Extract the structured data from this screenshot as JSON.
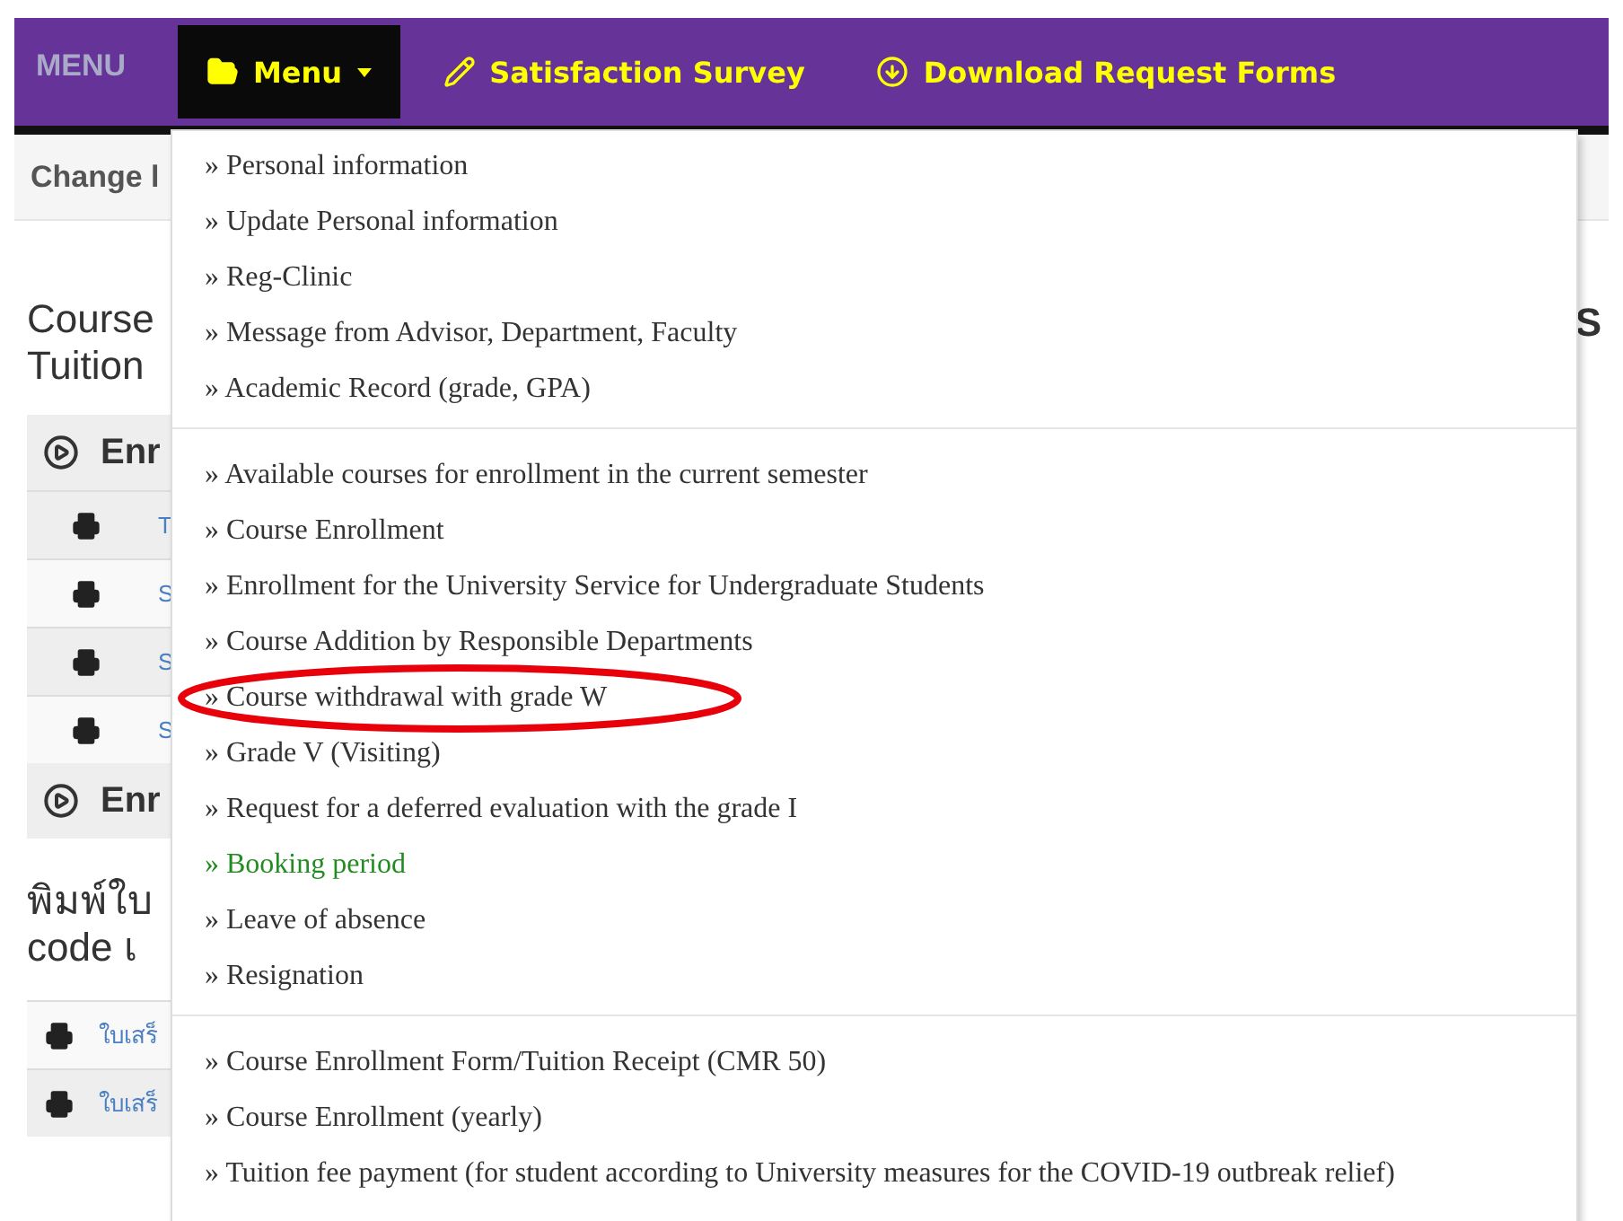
{
  "navbar": {
    "brand": "MENU",
    "items": [
      {
        "label": "Menu",
        "kind": "dropdown",
        "expanded": true
      },
      {
        "label": "Satisfaction Survey",
        "kind": "link"
      },
      {
        "label": "Download Request Forms",
        "kind": "link"
      }
    ]
  },
  "language_bar": {
    "label": "Change l"
  },
  "page": {
    "heading_lines": [
      "Course",
      "Tuition"
    ],
    "right_heading": "S",
    "panels": [
      {
        "title": "Enr",
        "rows": [
          "T",
          "S",
          "S",
          "S"
        ]
      },
      {
        "title": "Enr"
      }
    ],
    "print_heading_lines": [
      "พิมพ์ใบ",
      "code เ"
    ],
    "print_rows": [
      "ใบเสร็",
      "ใบเสร็"
    ]
  },
  "dropdown": {
    "groups": [
      {
        "items": [
          {
            "label": "» Personal information",
            "circled": false
          },
          {
            "label": "» Update Personal information",
            "circled": false
          },
          {
            "label": "» Reg-Clinic",
            "circled": false
          },
          {
            "label": "» Message from Advisor, Department, Faculty",
            "circled": false
          },
          {
            "label": "» Academic Record (grade, GPA)",
            "circled": false
          }
        ]
      },
      {
        "items": [
          {
            "label": "» Available courses for enrollment in the current semester",
            "circled": false
          },
          {
            "label": "» Course Enrollment",
            "circled": false
          },
          {
            "label": "» Enrollment for the University Service for Undergraduate Students",
            "circled": false
          },
          {
            "label": "» Course Addition by Responsible Departments",
            "circled": false
          },
          {
            "label": "» Course withdrawal with grade W",
            "circled": true
          },
          {
            "label": "» Grade V (Visiting)",
            "circled": false
          },
          {
            "label": "» Request for a deferred evaluation with the grade I",
            "circled": false
          },
          {
            "label": "» Booking period",
            "circled": false,
            "color": "#228b22"
          },
          {
            "label": "» Leave of absence",
            "circled": false
          },
          {
            "label": "» Resignation",
            "circled": false
          }
        ]
      },
      {
        "items": [
          {
            "label": "» Course Enrollment Form/Tuition Receipt (CMR 50)",
            "circled": false
          },
          {
            "label": "» Course Enrollment (yearly)",
            "circled": false
          },
          {
            "label": "» Tuition fee payment (for student according to University measures for the COVID-19 outbreak relief)",
            "circled": false
          }
        ]
      }
    ]
  }
}
